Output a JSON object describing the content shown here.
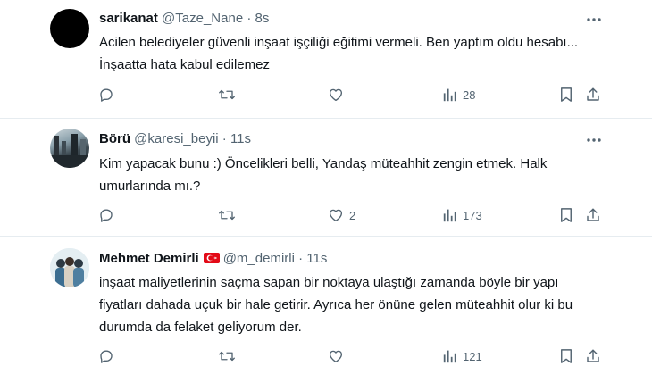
{
  "tweets": [
    {
      "name": "sarikanat",
      "handle": "@Taze_Nane",
      "separator": "·",
      "time": "8s",
      "text": "Acilen belediyeler güvenli inşaat işçiliği eğitimi vermeli. Ben yaptım oldu hesabı... İnşaatta hata kabul edilemez",
      "likes": "",
      "views": "28"
    },
    {
      "name": "Börü",
      "handle": "@karesi_beyii",
      "separator": "·",
      "time": "11s",
      "text": "Kim yapacak bunu :) Öncelikleri belli, Yandaş müteahhit zengin etmek. Halk umurlarında mı.?",
      "likes": "2",
      "views": "173"
    },
    {
      "name": "Mehmet Demirli",
      "handle": "@m_demirli",
      "separator": "·",
      "time": "11s",
      "text": "inşaat maliyetlerinin saçma sapan bir noktaya ulaştığı zamanda böyle bir yapı fiyatları dahada uçuk bir hale getirir. Ayrıca her önüne gelen müteahhit olur ki bu durumda da felaket geliyorum der.",
      "likes": "",
      "views": "121"
    }
  ],
  "icons": {
    "more": "more-horizontal-icon",
    "reply": "reply-icon",
    "retweet": "retweet-icon",
    "like": "heart-icon",
    "views": "views-bar-chart-icon",
    "bookmark": "bookmark-icon",
    "flag": "turkey-flag-icon"
  },
  "colors": {
    "text": "#0f1419",
    "muted": "#536471",
    "divider": "#e6ecf0",
    "flag_red": "#e30a17"
  }
}
